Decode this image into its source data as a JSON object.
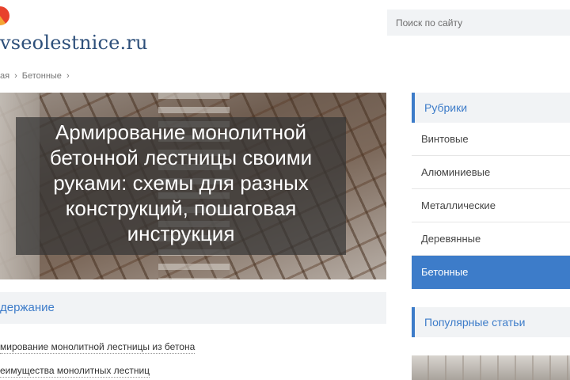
{
  "brand": {
    "logo_text": "vseolestnice.ru",
    "accent_color": "#3d7cc9"
  },
  "search": {
    "placeholder": "Поиск по сайту"
  },
  "breadcrumb": {
    "items": [
      "ая",
      "Бетонные"
    ],
    "separator": "›"
  },
  "article": {
    "title": "Армирование монолитной бетонной лестницы своими руками: схемы для разных конструкций, пошаговая инструкция"
  },
  "toc": {
    "title": "держание",
    "items": [
      "мирование монолитной лестницы из бетона",
      "еимущества монолитных лестниц"
    ]
  },
  "sidebar": {
    "rubrics_title": "Рубрики",
    "rubrics": [
      "Винтовые",
      "Алюминиевые",
      "Металлические",
      "Деревянные",
      "Бетонные"
    ],
    "active_rubric": "Бетонные",
    "popular_title": "Популярные статьи"
  }
}
